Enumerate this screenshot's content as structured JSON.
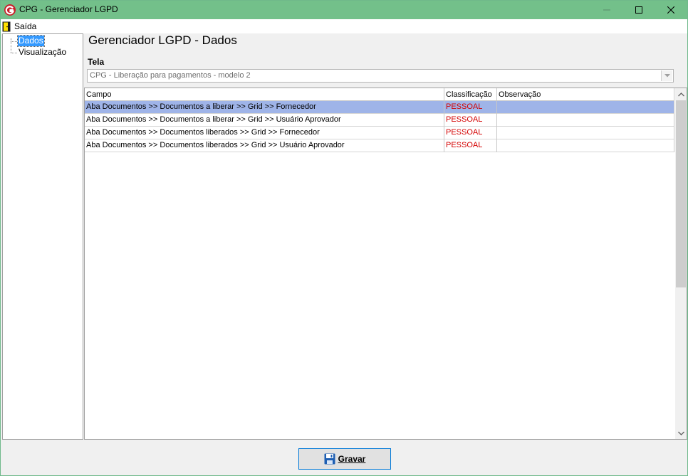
{
  "window": {
    "title": "CPG - Gerenciador LGPD",
    "icons": {
      "app": "app-logo-icon",
      "minimize": "minimize-icon",
      "maximize": "maximize-icon",
      "close": "close-icon"
    }
  },
  "menu": {
    "exit_label": "Saída",
    "exit_icon": "door-exit-icon"
  },
  "tree": {
    "items": [
      {
        "label": "Dados",
        "selected": true
      },
      {
        "label": "Visualização",
        "selected": false
      }
    ]
  },
  "main": {
    "title": "Gerenciador LGPD - Dados",
    "screen_label": "Tela",
    "screen_value": "CPG - Liberação para pagamentos - modelo 2"
  },
  "grid": {
    "columns": [
      "Campo",
      "Classificação",
      "Observação"
    ],
    "rows": [
      {
        "campo": "Aba Documentos >> Documentos a liberar >> Grid >> Fornecedor",
        "classificacao": "PESSOAL",
        "observacao": "",
        "selected": true
      },
      {
        "campo": "Aba Documentos >> Documentos a liberar >> Grid >> Usuário Aprovador",
        "classificacao": "PESSOAL",
        "observacao": "",
        "selected": false
      },
      {
        "campo": "Aba Documentos >> Documentos liberados >> Grid >> Fornecedor",
        "classificacao": "PESSOAL",
        "observacao": "",
        "selected": false
      },
      {
        "campo": "Aba Documentos >> Documentos liberados >> Grid >> Usuário Aprovador",
        "classificacao": "PESSOAL",
        "observacao": "",
        "selected": false
      }
    ]
  },
  "footer": {
    "save_label": "Gravar",
    "save_icon": "floppy-disk-icon"
  },
  "colors": {
    "titlebar": "#73c08a",
    "selection_row": "#9fb4e8",
    "classification_text": "#d40000",
    "tree_selected": "#3399ff"
  }
}
